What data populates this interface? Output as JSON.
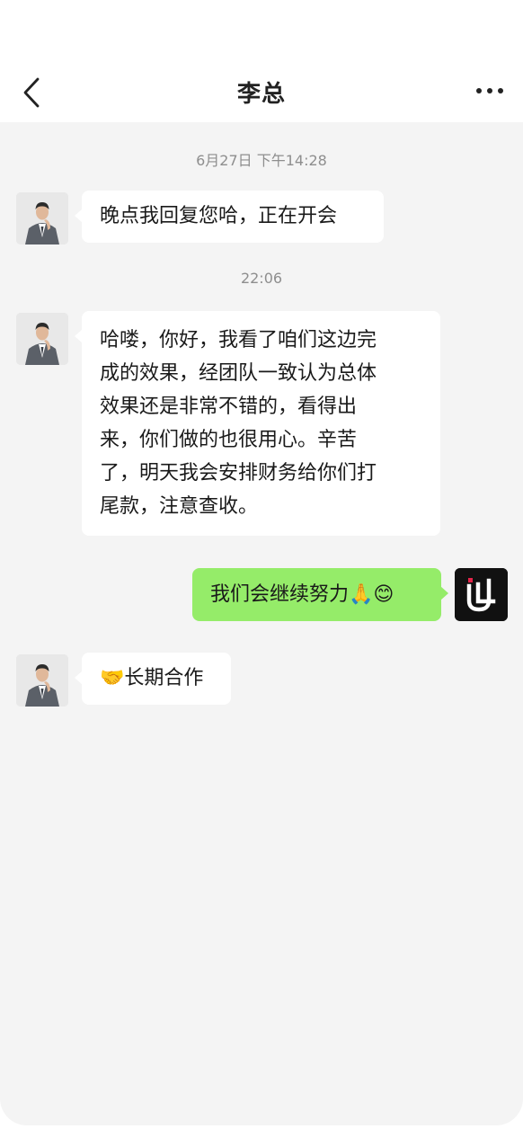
{
  "header": {
    "title": "李总",
    "back_icon": "chevron-left-icon",
    "more_icon": "more-horizontal-icon"
  },
  "messages": [
    {
      "type": "time",
      "text": "6月27日 下午14:28"
    },
    {
      "type": "in",
      "sender_avatar": "person-avatar",
      "text": "晚点我回复您哈，正在开会"
    },
    {
      "type": "time",
      "text": "22:06"
    },
    {
      "type": "in",
      "sender_avatar": "person-avatar",
      "lines": [
        "哈喽，你好，我看了咱们这边完",
        "成的效果，经团队一致认为总体",
        "效果还是非常不错的，看得出",
        "来，你们做的也很用心。辛苦",
        "了，明天我会安排财务给你们打",
        "尾款，注意查收。"
      ]
    },
    {
      "type": "out",
      "sender_avatar": "brand-logo-avatar",
      "text": "我们会继续努力🙏😊"
    },
    {
      "type": "in",
      "sender_avatar": "person-avatar",
      "text": "🤝长期合作"
    }
  ],
  "colors": {
    "chat_background": "#f4f4f4",
    "incoming_bubble": "#ffffff",
    "outgoing_bubble": "#95ec69",
    "timestamp_text": "#8e8e8e"
  }
}
